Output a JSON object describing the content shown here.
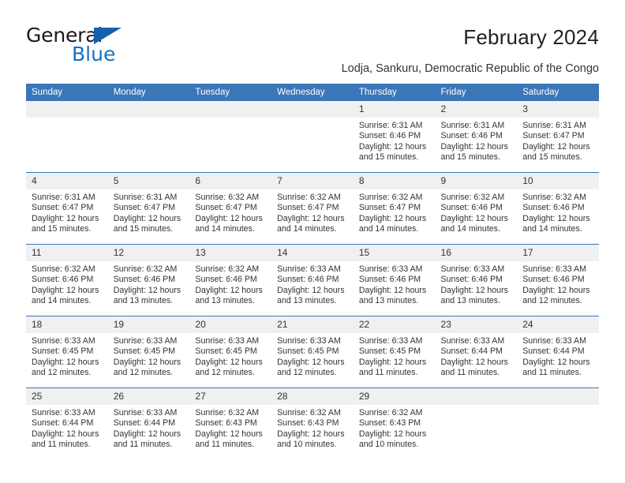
{
  "logo": {
    "word1": "General",
    "word2": "Blue",
    "triangle_color": "#1461ad",
    "word2_color": "#1272c4"
  },
  "header": {
    "title": "February 2024",
    "subtitle": "Lodja, Sankuru, Democratic Republic of the Congo"
  },
  "theme": {
    "header_blue": "#3a76b8",
    "daynum_bg": "#f0f0f0",
    "text": "#333333"
  },
  "calendar": {
    "weekday_headers": [
      "Sunday",
      "Monday",
      "Tuesday",
      "Wednesday",
      "Thursday",
      "Friday",
      "Saturday"
    ],
    "labels": {
      "sunrise": "Sunrise:",
      "sunset": "Sunset:",
      "daylight": "Daylight:"
    },
    "weeks": [
      [
        {
          "day": "",
          "sunrise": "",
          "sunset": "",
          "daylight_1": "",
          "daylight_2": ""
        },
        {
          "day": "",
          "sunrise": "",
          "sunset": "",
          "daylight_1": "",
          "daylight_2": ""
        },
        {
          "day": "",
          "sunrise": "",
          "sunset": "",
          "daylight_1": "",
          "daylight_2": ""
        },
        {
          "day": "",
          "sunrise": "",
          "sunset": "",
          "daylight_1": "",
          "daylight_2": ""
        },
        {
          "day": "1",
          "sunrise": "Sunrise: 6:31 AM",
          "sunset": "Sunset: 6:46 PM",
          "daylight_1": "Daylight: 12 hours",
          "daylight_2": "and 15 minutes."
        },
        {
          "day": "2",
          "sunrise": "Sunrise: 6:31 AM",
          "sunset": "Sunset: 6:46 PM",
          "daylight_1": "Daylight: 12 hours",
          "daylight_2": "and 15 minutes."
        },
        {
          "day": "3",
          "sunrise": "Sunrise: 6:31 AM",
          "sunset": "Sunset: 6:47 PM",
          "daylight_1": "Daylight: 12 hours",
          "daylight_2": "and 15 minutes."
        }
      ],
      [
        {
          "day": "4",
          "sunrise": "Sunrise: 6:31 AM",
          "sunset": "Sunset: 6:47 PM",
          "daylight_1": "Daylight: 12 hours",
          "daylight_2": "and 15 minutes."
        },
        {
          "day": "5",
          "sunrise": "Sunrise: 6:31 AM",
          "sunset": "Sunset: 6:47 PM",
          "daylight_1": "Daylight: 12 hours",
          "daylight_2": "and 15 minutes."
        },
        {
          "day": "6",
          "sunrise": "Sunrise: 6:32 AM",
          "sunset": "Sunset: 6:47 PM",
          "daylight_1": "Daylight: 12 hours",
          "daylight_2": "and 14 minutes."
        },
        {
          "day": "7",
          "sunrise": "Sunrise: 6:32 AM",
          "sunset": "Sunset: 6:47 PM",
          "daylight_1": "Daylight: 12 hours",
          "daylight_2": "and 14 minutes."
        },
        {
          "day": "8",
          "sunrise": "Sunrise: 6:32 AM",
          "sunset": "Sunset: 6:47 PM",
          "daylight_1": "Daylight: 12 hours",
          "daylight_2": "and 14 minutes."
        },
        {
          "day": "9",
          "sunrise": "Sunrise: 6:32 AM",
          "sunset": "Sunset: 6:46 PM",
          "daylight_1": "Daylight: 12 hours",
          "daylight_2": "and 14 minutes."
        },
        {
          "day": "10",
          "sunrise": "Sunrise: 6:32 AM",
          "sunset": "Sunset: 6:46 PM",
          "daylight_1": "Daylight: 12 hours",
          "daylight_2": "and 14 minutes."
        }
      ],
      [
        {
          "day": "11",
          "sunrise": "Sunrise: 6:32 AM",
          "sunset": "Sunset: 6:46 PM",
          "daylight_1": "Daylight: 12 hours",
          "daylight_2": "and 14 minutes."
        },
        {
          "day": "12",
          "sunrise": "Sunrise: 6:32 AM",
          "sunset": "Sunset: 6:46 PM",
          "daylight_1": "Daylight: 12 hours",
          "daylight_2": "and 13 minutes."
        },
        {
          "day": "13",
          "sunrise": "Sunrise: 6:32 AM",
          "sunset": "Sunset: 6:46 PM",
          "daylight_1": "Daylight: 12 hours",
          "daylight_2": "and 13 minutes."
        },
        {
          "day": "14",
          "sunrise": "Sunrise: 6:33 AM",
          "sunset": "Sunset: 6:46 PM",
          "daylight_1": "Daylight: 12 hours",
          "daylight_2": "and 13 minutes."
        },
        {
          "day": "15",
          "sunrise": "Sunrise: 6:33 AM",
          "sunset": "Sunset: 6:46 PM",
          "daylight_1": "Daylight: 12 hours",
          "daylight_2": "and 13 minutes."
        },
        {
          "day": "16",
          "sunrise": "Sunrise: 6:33 AM",
          "sunset": "Sunset: 6:46 PM",
          "daylight_1": "Daylight: 12 hours",
          "daylight_2": "and 13 minutes."
        },
        {
          "day": "17",
          "sunrise": "Sunrise: 6:33 AM",
          "sunset": "Sunset: 6:46 PM",
          "daylight_1": "Daylight: 12 hours",
          "daylight_2": "and 12 minutes."
        }
      ],
      [
        {
          "day": "18",
          "sunrise": "Sunrise: 6:33 AM",
          "sunset": "Sunset: 6:45 PM",
          "daylight_1": "Daylight: 12 hours",
          "daylight_2": "and 12 minutes."
        },
        {
          "day": "19",
          "sunrise": "Sunrise: 6:33 AM",
          "sunset": "Sunset: 6:45 PM",
          "daylight_1": "Daylight: 12 hours",
          "daylight_2": "and 12 minutes."
        },
        {
          "day": "20",
          "sunrise": "Sunrise: 6:33 AM",
          "sunset": "Sunset: 6:45 PM",
          "daylight_1": "Daylight: 12 hours",
          "daylight_2": "and 12 minutes."
        },
        {
          "day": "21",
          "sunrise": "Sunrise: 6:33 AM",
          "sunset": "Sunset: 6:45 PM",
          "daylight_1": "Daylight: 12 hours",
          "daylight_2": "and 12 minutes."
        },
        {
          "day": "22",
          "sunrise": "Sunrise: 6:33 AM",
          "sunset": "Sunset: 6:45 PM",
          "daylight_1": "Daylight: 12 hours",
          "daylight_2": "and 11 minutes."
        },
        {
          "day": "23",
          "sunrise": "Sunrise: 6:33 AM",
          "sunset": "Sunset: 6:44 PM",
          "daylight_1": "Daylight: 12 hours",
          "daylight_2": "and 11 minutes."
        },
        {
          "day": "24",
          "sunrise": "Sunrise: 6:33 AM",
          "sunset": "Sunset: 6:44 PM",
          "daylight_1": "Daylight: 12 hours",
          "daylight_2": "and 11 minutes."
        }
      ],
      [
        {
          "day": "25",
          "sunrise": "Sunrise: 6:33 AM",
          "sunset": "Sunset: 6:44 PM",
          "daylight_1": "Daylight: 12 hours",
          "daylight_2": "and 11 minutes."
        },
        {
          "day": "26",
          "sunrise": "Sunrise: 6:33 AM",
          "sunset": "Sunset: 6:44 PM",
          "daylight_1": "Daylight: 12 hours",
          "daylight_2": "and 11 minutes."
        },
        {
          "day": "27",
          "sunrise": "Sunrise: 6:32 AM",
          "sunset": "Sunset: 6:43 PM",
          "daylight_1": "Daylight: 12 hours",
          "daylight_2": "and 11 minutes."
        },
        {
          "day": "28",
          "sunrise": "Sunrise: 6:32 AM",
          "sunset": "Sunset: 6:43 PM",
          "daylight_1": "Daylight: 12 hours",
          "daylight_2": "and 10 minutes."
        },
        {
          "day": "29",
          "sunrise": "Sunrise: 6:32 AM",
          "sunset": "Sunset: 6:43 PM",
          "daylight_1": "Daylight: 12 hours",
          "daylight_2": "and 10 minutes."
        },
        {
          "day": "",
          "sunrise": "",
          "sunset": "",
          "daylight_1": "",
          "daylight_2": ""
        },
        {
          "day": "",
          "sunrise": "",
          "sunset": "",
          "daylight_1": "",
          "daylight_2": ""
        }
      ]
    ]
  }
}
